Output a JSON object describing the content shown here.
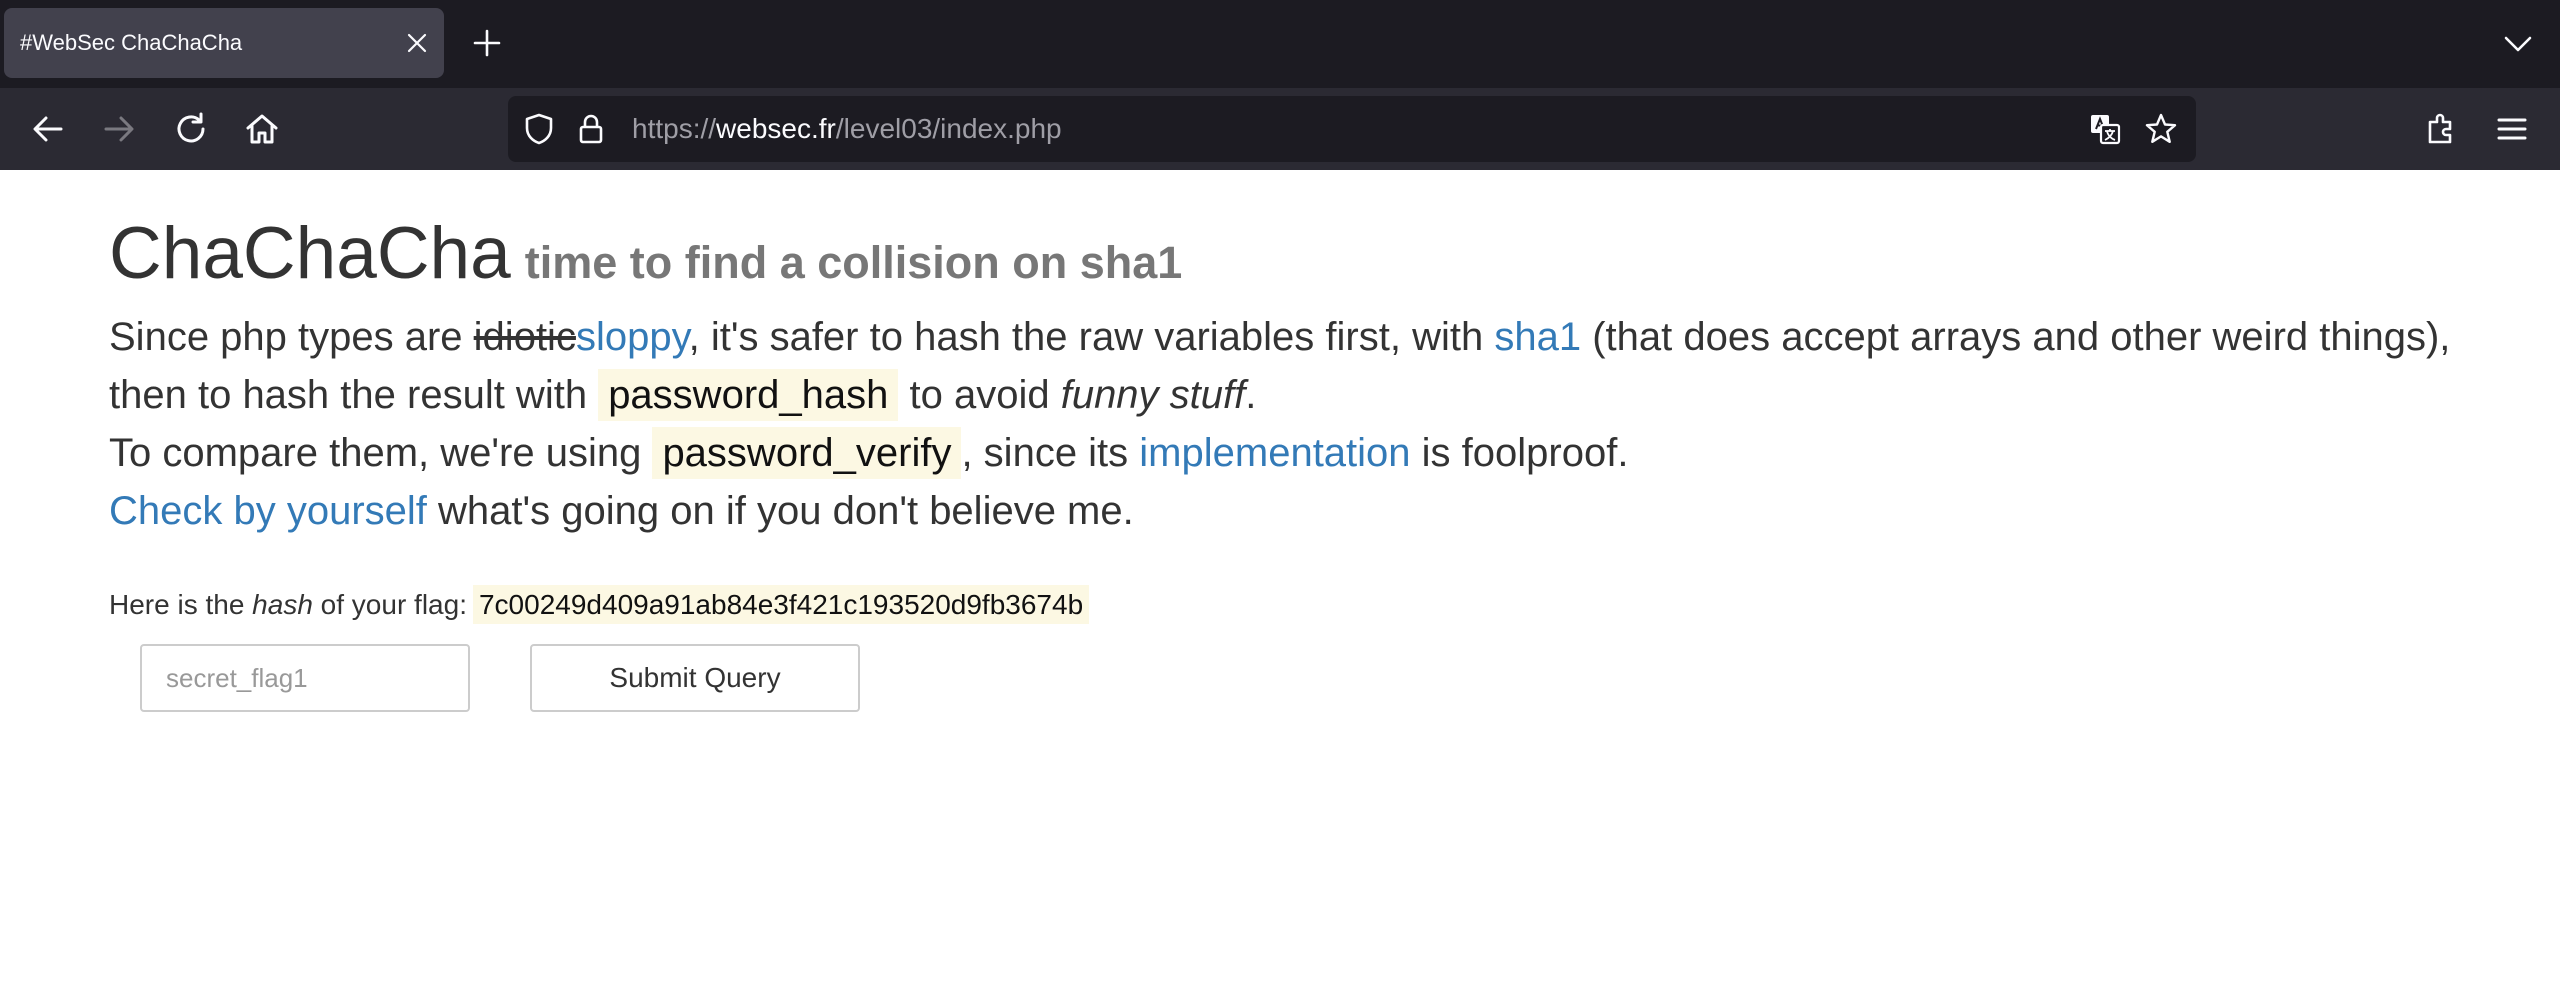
{
  "browser": {
    "tab_title": "#WebSec ChaChaCha",
    "url_scheme": "https://",
    "url_host": "websec.fr",
    "url_path": "/level03/index.php"
  },
  "page": {
    "title": "ChaChaCha",
    "subtitle": "time to find a collision on sha1",
    "p1": {
      "t1": "Since php types are ",
      "struck": "idiotic",
      "link_sloppy": "sloppy",
      "t2": ", it's safer to hash the raw variables first, with ",
      "link_sha1": "sha1",
      "t3": " (that does accept arrays and other weird things), then to hash the result with ",
      "code_password_hash": "password_hash",
      "t4": " to avoid ",
      "em_funny": "funny stuff",
      "t5": "."
    },
    "p2": {
      "t1": "To compare them, we're using ",
      "code_password_verify": "password_verify",
      "t2": ", since its ",
      "link_implementation": "implementation",
      "t3": " is ",
      "strong_foolproof": "foolproof",
      "t4": "."
    },
    "p3": {
      "link_check": "Check by yourself",
      "t1": " what's going on if you don't believe me."
    },
    "flag": {
      "t1": "Here is the ",
      "em_hash": "hash",
      "t2": " of your flag:",
      "hash_value": "7c00249d409a91ab84e3f421c193520d9fb3674b"
    },
    "form": {
      "input_placeholder": "secret_flag1",
      "input_value": "",
      "submit_label": "Submit Query"
    }
  },
  "colors": {
    "link": "#337ab7",
    "code_bg": "#fcf8e3",
    "chrome_dark": "#1c1b22",
    "chrome_nav": "#2b2a33"
  }
}
